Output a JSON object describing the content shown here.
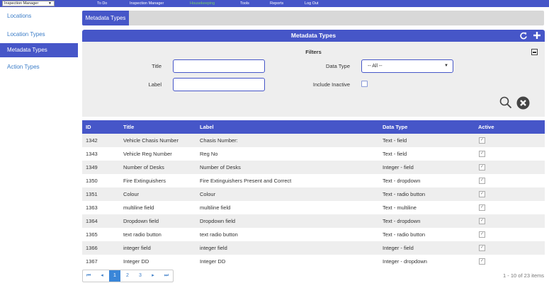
{
  "app_select": {
    "value": "Inspection Manager"
  },
  "topnav": [
    "To Do",
    "Inspection Manager",
    "Housekeeping",
    "Tools",
    "Reports",
    "Log Out"
  ],
  "sidebar": {
    "items": [
      {
        "label": "Locations"
      },
      {
        "label": "Location Types"
      },
      {
        "label": "Metadata Types"
      },
      {
        "label": "Action Types"
      }
    ]
  },
  "tab": {
    "label": "Metadata Types"
  },
  "panel": {
    "title": "Metadata Types"
  },
  "filters": {
    "title": "Filters",
    "title_label": "Title",
    "label_label": "Label",
    "data_type_label": "Data Type",
    "data_type_value": "-- All --",
    "include_inactive_label": "Include Inactive"
  },
  "table": {
    "headers": [
      "ID",
      "Title",
      "Label",
      "Data Type",
      "Active"
    ],
    "rows": [
      [
        "1342",
        "Vehicle Chasis Number",
        "Chasis Number:",
        "Text - field"
      ],
      [
        "1343",
        "Vehicle Reg Number",
        "Reg No",
        "Text - field"
      ],
      [
        "1349",
        "Number of Desks",
        "Number of Desks",
        "Integer - field"
      ],
      [
        "1350",
        "Fire Extinguishers",
        "Fire Extinguishers Present and Correct",
        "Text - dropdown"
      ],
      [
        "1351",
        "Colour",
        "Colour",
        "Text - radio button"
      ],
      [
        "1363",
        "multiline field",
        "multiline field",
        "Text - multiline"
      ],
      [
        "1364",
        "Dropdown field",
        "Dropdown field",
        "Text - dropdown"
      ],
      [
        "1365",
        "text radio button",
        "text radio button",
        "Text - radio button"
      ],
      [
        "1366",
        "integer field",
        "integer field",
        "Integer - field"
      ],
      [
        "1367",
        "Integer DD",
        "Integer DD",
        "Integer - dropdown"
      ]
    ]
  },
  "pager": {
    "first": "⏮",
    "prev": "◂",
    "pages": [
      "1",
      "2",
      "3"
    ],
    "next": "▸",
    "last": "⏭",
    "info": "1 - 10 of 23 items"
  },
  "colors": {
    "primary": "#4656c8",
    "link": "#3a7cc7",
    "active_nav": "#7ad06a"
  }
}
